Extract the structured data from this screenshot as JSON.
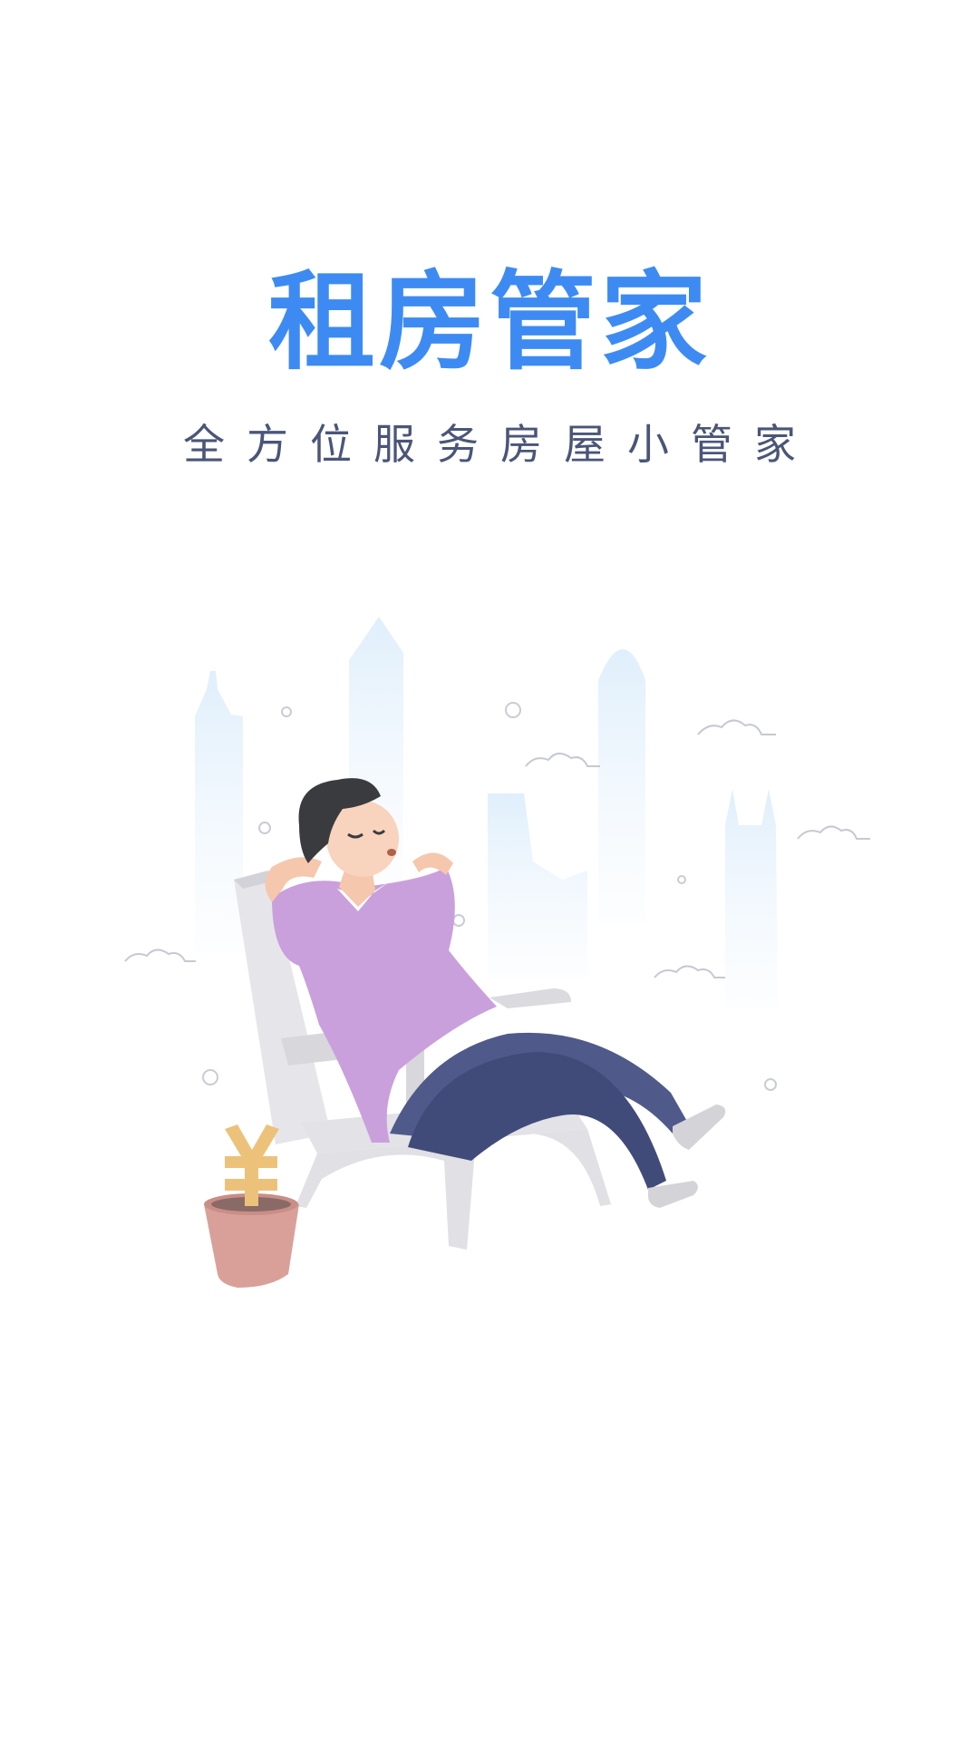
{
  "splash": {
    "app_title": "租房管家",
    "tagline": "全方位服务房屋小管家",
    "illustration": "man-relaxing-in-chair-illustration",
    "currency_plant_symbol": "¥"
  },
  "colors": {
    "title": "#3d8bf2",
    "tagline": "#4a5578",
    "background": "#ffffff",
    "shirt": "#c9a0dc",
    "pants": "#4f5a8a",
    "chair": "#e4e4e8",
    "buildings": "#e8f3fc",
    "pot": "#d9a09a",
    "coin_plant": "#ecc27a"
  }
}
